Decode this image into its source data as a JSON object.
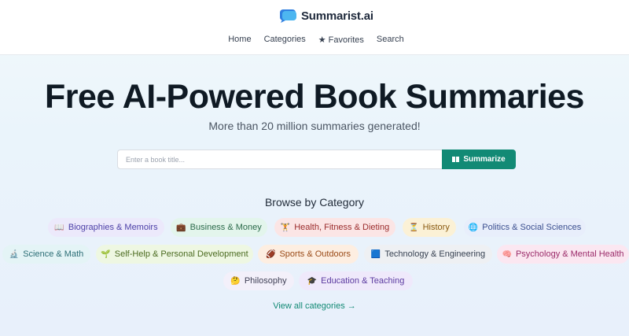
{
  "header": {
    "logo_text": "Summarist.ai",
    "nav": [
      "Home",
      "Categories",
      "★ Favorites",
      "Search"
    ]
  },
  "hero": {
    "title": "Free AI-Powered Book Summaries",
    "subtitle": "More than 20 million summaries generated!"
  },
  "search": {
    "placeholder": "Enter a book title...",
    "value": "",
    "button_label": "Summarize",
    "button_icon": "book-icon"
  },
  "browse": {
    "title": "Browse by Category",
    "categories": [
      {
        "icon": "📖",
        "icon_name": "open-book-icon",
        "label": "Biographies & Memoirs",
        "bg": "#ece9fb",
        "color": "#4c3fa7"
      },
      {
        "icon": "💼",
        "icon_name": "briefcase-icon",
        "label": "Business & Money",
        "bg": "#e3f5ec",
        "color": "#2c6b4b"
      },
      {
        "icon": "🏋",
        "icon_name": "weightlifter-icon",
        "label": "Health, Fitness & Dieting",
        "bg": "#fbe5e5",
        "color": "#9b2c2c"
      },
      {
        "icon": "⏳",
        "icon_name": "hourglass-icon",
        "label": "History",
        "bg": "#fbf1d6",
        "color": "#8a5a10"
      },
      {
        "icon": "🌐",
        "icon_name": "globe-icon",
        "label": "Politics & Social Sciences",
        "bg": "#e8eefb",
        "color": "#3b4f8f"
      },
      {
        "icon": "🔬",
        "icon_name": "microscope-icon",
        "label": "Science & Math",
        "bg": "#e4f4f6",
        "color": "#2b6d75"
      },
      {
        "icon": "🌱",
        "icon_name": "seedling-icon",
        "label": "Self-Help & Personal Development",
        "bg": "#eef7e2",
        "color": "#4a6a1f"
      },
      {
        "icon": "🏈",
        "icon_name": "football-icon",
        "label": "Sports & Outdoors",
        "bg": "#fdeee1",
        "color": "#9a4a17"
      },
      {
        "icon": "🟦",
        "icon_name": "tablet-icon",
        "label": "Technology & Engineering",
        "bg": "#eef0f3",
        "color": "#374151"
      },
      {
        "icon": "🧠",
        "icon_name": "brain-icon",
        "label": "Psychology & Mental Health",
        "bg": "#fbe7f1",
        "color": "#9b2c6a"
      },
      {
        "icon": "🤔",
        "icon_name": "thinking-face-icon",
        "label": "Philosophy",
        "bg": "#f3f0fa",
        "color": "#3f3f55"
      },
      {
        "icon": "🎓",
        "icon_name": "graduation-cap-icon",
        "label": "Education & Teaching",
        "bg": "#efe9fb",
        "color": "#5b3aa0"
      }
    ],
    "view_all": "View all categories →"
  },
  "colors": {
    "accent": "#128a75",
    "title": "#0f1a24"
  }
}
